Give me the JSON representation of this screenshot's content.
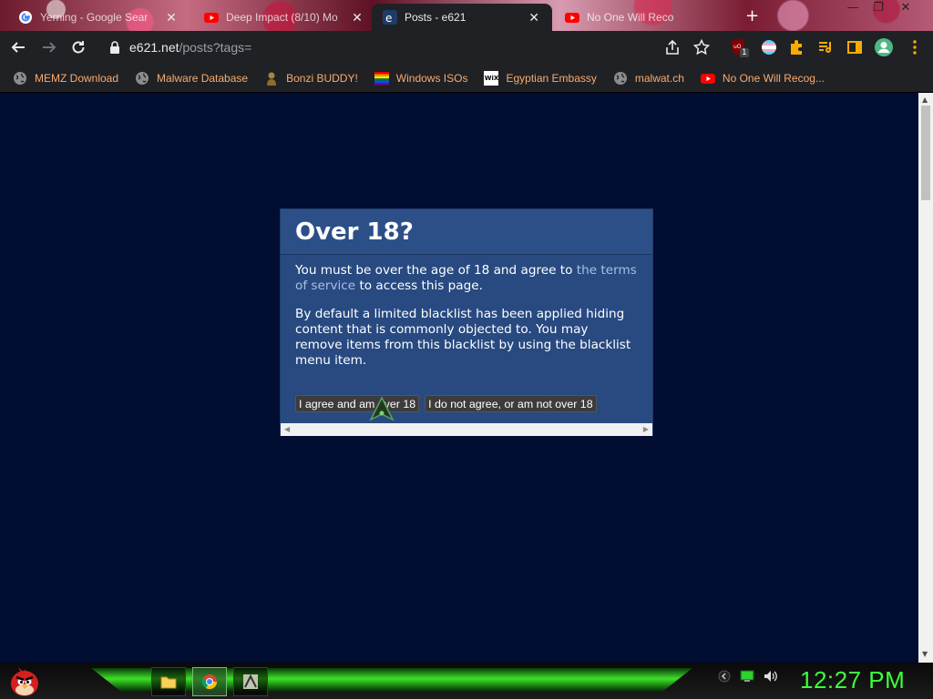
{
  "browser": {
    "tabs": [
      {
        "title": "Yerning - Google Sear",
        "icon": "google-icon",
        "active": false
      },
      {
        "title": "Deep Impact (8/10) Mo",
        "icon": "youtube-icon",
        "active": false
      },
      {
        "title": "Posts - e621",
        "icon": "e621-icon",
        "active": true
      },
      {
        "title": "No One Will Reco",
        "icon": "youtube-icon",
        "active": false
      }
    ],
    "tab_close": "✕",
    "new_tab": "+",
    "window_controls": {
      "minimize": "—",
      "restore": "❐",
      "close": "✕"
    },
    "url_host": "e621.net",
    "url_path": "/posts?tags=",
    "extension_badge": "1",
    "bookmarks": [
      {
        "label": "MEMZ Download",
        "icon": "globe-icon"
      },
      {
        "label": "Malware Database",
        "icon": "globe-icon"
      },
      {
        "label": "Bonzi BUDDY!",
        "icon": "bonzi-icon"
      },
      {
        "label": "Windows ISOs",
        "icon": "windows-rainbow-icon"
      },
      {
        "label": "Egyptian Embassy",
        "icon": "wix-icon"
      },
      {
        "label": "malwat.ch",
        "icon": "globe-icon"
      },
      {
        "label": "No One Will Recog...",
        "icon": "youtube-icon"
      }
    ],
    "wix_text": "WiX"
  },
  "dialog": {
    "title": "Over 18?",
    "para1_before": "You must be over the age of 18 and agree to ",
    "para1_link": "the terms of service",
    "para1_after": " to access this page.",
    "para2": "By default a limited blacklist has been applied hiding content that is commonly objected to. You may remove items from this blacklist by using the blacklist menu item.",
    "agree_button": "I agree and am over 18",
    "disagree_button": "I do not agree, or am not over 18"
  },
  "taskbar": {
    "clock": "12:27 PM"
  },
  "colors": {
    "page_background": "#010d31",
    "dialog_background": "#284a81",
    "bookmark_text": "#f9ab6f",
    "clock_green": "#3dff3d"
  }
}
